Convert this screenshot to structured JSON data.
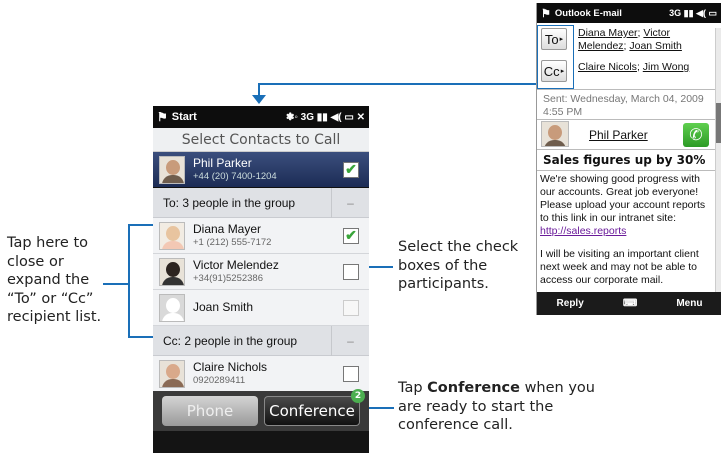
{
  "left_phone": {
    "status_bar": {
      "title": "Start",
      "icons": "❃◦ 3G ▮▮ ◀( ▭ ✕"
    },
    "screen_title": "Select Contacts to Call",
    "contacts_top": {
      "name": "Phil Parker",
      "number": "+44 (20) 7400-1204",
      "checked": true
    },
    "to_group": {
      "label": "To: 3 people in the group",
      "toggle": "–"
    },
    "to_contacts": [
      {
        "name": "Diana Mayer",
        "number": "+1 (212) 555-7172",
        "checked": true
      },
      {
        "name": "Victor Melendez",
        "number": "+34(91)5252386",
        "checked": false
      },
      {
        "name": "Joan Smith",
        "number": "",
        "checked": false
      }
    ],
    "cc_group": {
      "label": "Cc: 2 people in the group",
      "toggle": "–"
    },
    "cc_contacts": [
      {
        "name": "Claire Nichols",
        "number": "0920289411",
        "checked": false
      }
    ],
    "buttons": {
      "phone": "Phone",
      "conference": "Conference",
      "badge": "2"
    }
  },
  "right_phone": {
    "status_bar": {
      "title": "Outlook E-mail",
      "icons": "3G ▮▮ ◀( ▭"
    },
    "to_label": "To",
    "cc_label": "Cc",
    "to_recipients": [
      "Diana Mayer",
      "Victor Melendez",
      "Joan Smith"
    ],
    "cc_recipients": [
      "Claire Nicols",
      "Jim Wong"
    ],
    "sent": "Sent: Wednesday, March 04, 2009 4:55 PM",
    "sender": "Phil Parker",
    "subject": "Sales figures up by 30%",
    "body_1": "We're showing good progress with our accounts. Great job everyone! Please upload your account reports to this link in our intranet site:",
    "body_link": "http://sales.reports",
    "body_2": "I will be visiting an important client next week and may not be able to access our corporate mail.",
    "bottom": {
      "left": "Reply",
      "middle": "⌨",
      "right": "Menu"
    }
  },
  "callouts": {
    "left": "Tap here to close or expand the “To” or “Cc” recipient list.",
    "middle": "Select the check boxes of the participants.",
    "bottom_prefix": "Tap ",
    "bottom_bold": "Conference",
    "bottom_suffix": " when you are ready to start the conference call."
  },
  "colors": {
    "callout_line": "#1a6fb8",
    "checkmark": "#3aa53a"
  }
}
